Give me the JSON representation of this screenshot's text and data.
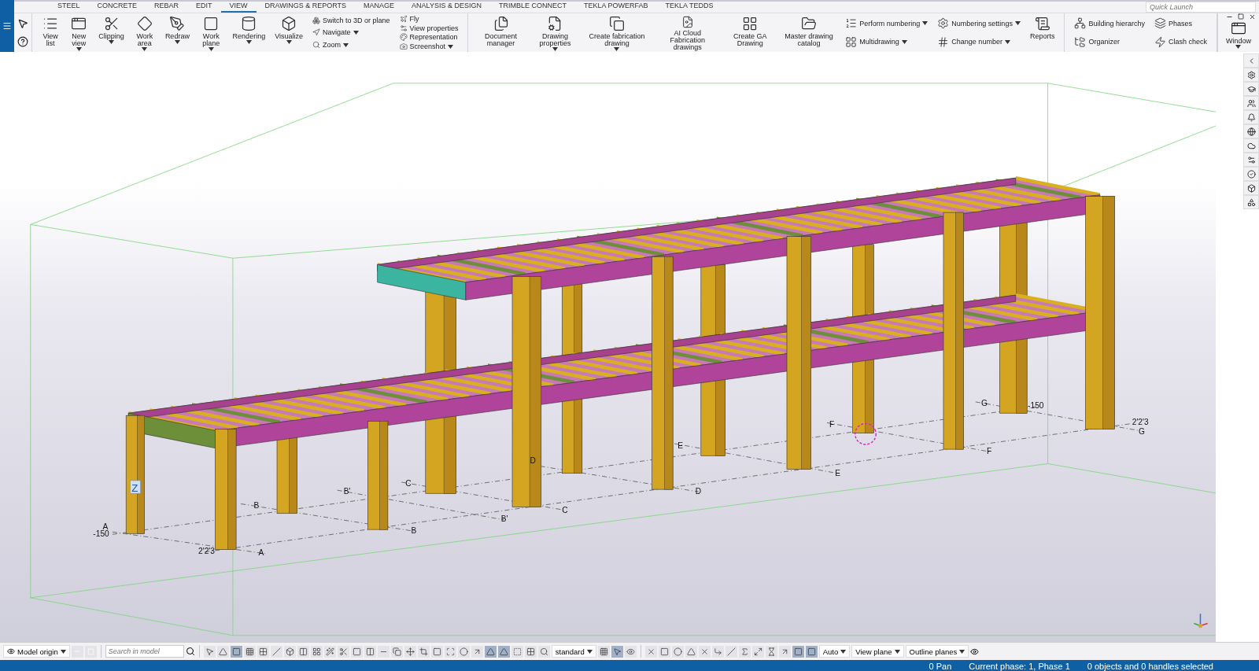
{
  "tabs": [
    {
      "label": "STEEL",
      "selected": false
    },
    {
      "label": "CONCRETE",
      "selected": false
    },
    {
      "label": "REBAR",
      "selected": false
    },
    {
      "label": "EDIT",
      "selected": false
    },
    {
      "label": "VIEW",
      "selected": true
    },
    {
      "label": "DRAWINGS & REPORTS",
      "selected": false
    },
    {
      "label": "MANAGE",
      "selected": false
    },
    {
      "label": "ANALYSIS & DESIGN",
      "selected": false
    },
    {
      "label": "TRIMBLE CONNECT",
      "selected": false
    },
    {
      "label": "TEKLA POWERFAB",
      "selected": false
    },
    {
      "label": "TEKLA TEDDS",
      "selected": false
    }
  ],
  "quick_launch": {
    "placeholder": "Quick Launch"
  },
  "ribbon": {
    "groups": [
      {
        "items": [
          {
            "kind": "large",
            "label": "View list",
            "dropdown": false
          },
          {
            "kind": "large",
            "label": "New view",
            "dropdown": true
          },
          {
            "kind": "large",
            "label": "Clipping",
            "dropdown": true
          },
          {
            "kind": "large",
            "label": "Work area",
            "dropdown": true
          },
          {
            "kind": "large",
            "label": "Redraw",
            "dropdown": true
          },
          {
            "kind": "large",
            "label": "Work plane",
            "dropdown": true
          },
          {
            "kind": "large",
            "label": "Rendering",
            "dropdown": true
          },
          {
            "kind": "large",
            "label": "Visualize",
            "dropdown": true
          },
          {
            "kind": "column",
            "items": [
              {
                "label": "Switch to 3D or plane",
                "dropdown": false
              },
              {
                "label": "Navigate",
                "dropdown": true
              },
              {
                "label": "Zoom",
                "dropdown": true
              }
            ]
          },
          {
            "kind": "column",
            "items": [
              {
                "label": "Fly",
                "dropdown": false
              },
              {
                "label": "View properties",
                "dropdown": false
              },
              {
                "label": "Representation",
                "dropdown": false
              },
              {
                "label": "Screenshot",
                "dropdown": true
              }
            ]
          }
        ]
      },
      {
        "items": [
          {
            "kind": "large",
            "label": "Document manager",
            "dropdown": false
          },
          {
            "kind": "large",
            "label": "Drawing properties",
            "dropdown": true
          },
          {
            "kind": "large",
            "label": "Create fabrication drawing",
            "dropdown": true
          },
          {
            "kind": "large",
            "label": "AI Cloud Fabrication drawings",
            "dropdown": false
          },
          {
            "kind": "large",
            "label": "Create GA Drawing",
            "dropdown": false
          },
          {
            "kind": "large",
            "label": "Master drawing catalog",
            "dropdown": false
          },
          {
            "kind": "column",
            "items": [
              {
                "label": "Perform numbering",
                "dropdown": true
              },
              {
                "label": "Multidrawing",
                "dropdown": true
              }
            ]
          },
          {
            "kind": "column",
            "items": [
              {
                "label": "Numbering settings",
                "dropdown": true
              },
              {
                "label": "Change number",
                "dropdown": true
              }
            ]
          },
          {
            "kind": "large",
            "label": "Reports",
            "dropdown": false
          }
        ]
      },
      {
        "items": [
          {
            "kind": "column",
            "items": [
              {
                "label": "Building hierarchy",
                "dropdown": false
              },
              {
                "label": "Organizer",
                "dropdown": false
              }
            ]
          },
          {
            "kind": "column",
            "items": [
              {
                "label": "Phases",
                "dropdown": false
              },
              {
                "label": "Clash check",
                "dropdown": false
              }
            ]
          }
        ]
      }
    ]
  },
  "window_button": {
    "label": "Window",
    "dropdown": true
  },
  "viewport": {
    "axis_label": "Z",
    "grid_labels": [
      "A",
      "-150",
      "2'2'3",
      "A",
      "B",
      "B",
      "B'",
      "B'",
      "C",
      "C",
      "D",
      "D",
      "E",
      "E",
      "F",
      "F",
      "G",
      "-150",
      "2'2'3",
      "G"
    ]
  },
  "bottom_toolbar": {
    "origin": "Model origin",
    "search_placeholder": "Search in model",
    "dropdowns": [
      "standard",
      "Auto",
      "View plane",
      "Outline planes"
    ]
  },
  "status_bar": {
    "pan": "0 Pan",
    "phase": "Current phase: 1, Phase 1",
    "selection": "0 objects and 0 handles selected"
  }
}
